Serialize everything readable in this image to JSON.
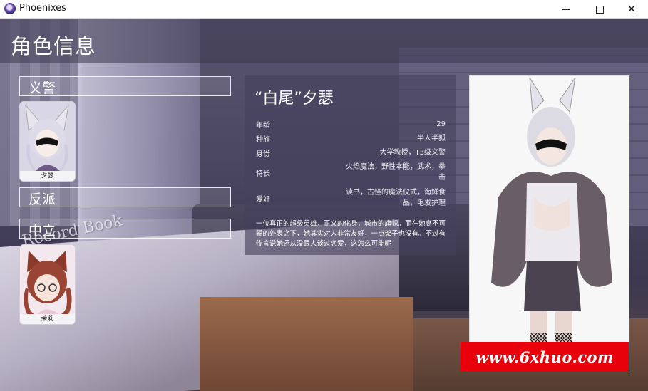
{
  "window": {
    "title": "Phoenixes",
    "minimize_icon": "minimize-icon",
    "maximize_icon": "maximize-icon",
    "close_icon": "close-icon"
  },
  "page_title": "角色信息",
  "categories": [
    {
      "label": "义警",
      "cards": [
        {
          "name": "夕瑟"
        }
      ]
    },
    {
      "label": "反派",
      "cards": []
    },
    {
      "label": "中立",
      "cards": [
        {
          "name": "茉莉"
        }
      ]
    }
  ],
  "stamp_text": "Record Book",
  "character": {
    "title_prefix": "“白尾”",
    "title_name": "夕瑟",
    "fields": [
      {
        "key": "年龄",
        "value": "29"
      },
      {
        "key": "种族",
        "value": "半人半狐"
      },
      {
        "key": "身份",
        "value": "大学教授，T3级义警"
      },
      {
        "key": "特长",
        "value": "火焰魔法，野性本能，武术，拳击"
      },
      {
        "key": "爱好",
        "value": "读书，古怪的魔法仪式，海鲜食品，毛发护理"
      }
    ],
    "bio": "一位真正的超级英雄，正义的化身，城市的旗帜。而在她高不可攀的外表之下，她其实对人非常友好，一点架子也没有。不过有传言说她还从没跟人谈过恋爱，这怎么可能呢"
  },
  "watermark": "www.6xhuo.com",
  "colors": {
    "banner": "#e8000a"
  }
}
